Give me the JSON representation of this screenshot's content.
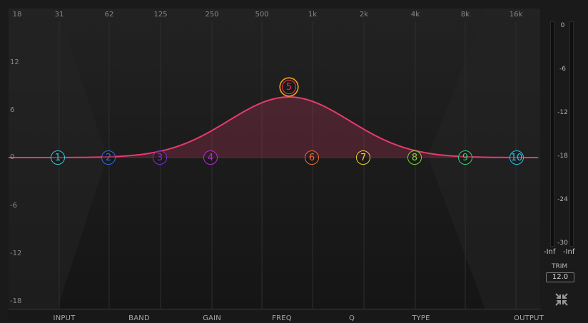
{
  "eq": {
    "freq_labels": [
      "18",
      "31",
      "62",
      "125",
      "250",
      "500",
      "1k",
      "2k",
      "4k",
      "8k",
      "16k"
    ],
    "gain_labels": [
      "12",
      "6",
      "0",
      "-6",
      "-12",
      "-18"
    ],
    "bands": [
      {
        "label": "1",
        "color": "#35c6d8"
      },
      {
        "label": "2",
        "color": "#2d6fe0"
      },
      {
        "label": "3",
        "color": "#7b2fd6"
      },
      {
        "label": "4",
        "color": "#b72ad1"
      },
      {
        "label": "5",
        "color": "#e8304e",
        "ring": "#f0a31d",
        "active": true
      },
      {
        "label": "6",
        "color": "#ef6a2c"
      },
      {
        "label": "7",
        "color": "#f1d12a"
      },
      {
        "label": "8",
        "color": "#7ad23c"
      },
      {
        "label": "9",
        "color": "#2fd07c"
      },
      {
        "label": "10",
        "color": "#2ec1e0"
      }
    ],
    "curve_color": "#e83a6c"
  },
  "meter": {
    "scale": [
      "0",
      "-6",
      "-12",
      "-18",
      "-24",
      "-30"
    ],
    "left_peak": "-Inf",
    "right_peak": "-Inf"
  },
  "trim": {
    "label": "TRIM",
    "value": "12.0"
  },
  "footer": {
    "labels": [
      "INPUT",
      "BAND",
      "GAIN",
      "FREQ",
      "Q",
      "TYPE",
      "OUTPUT"
    ]
  }
}
